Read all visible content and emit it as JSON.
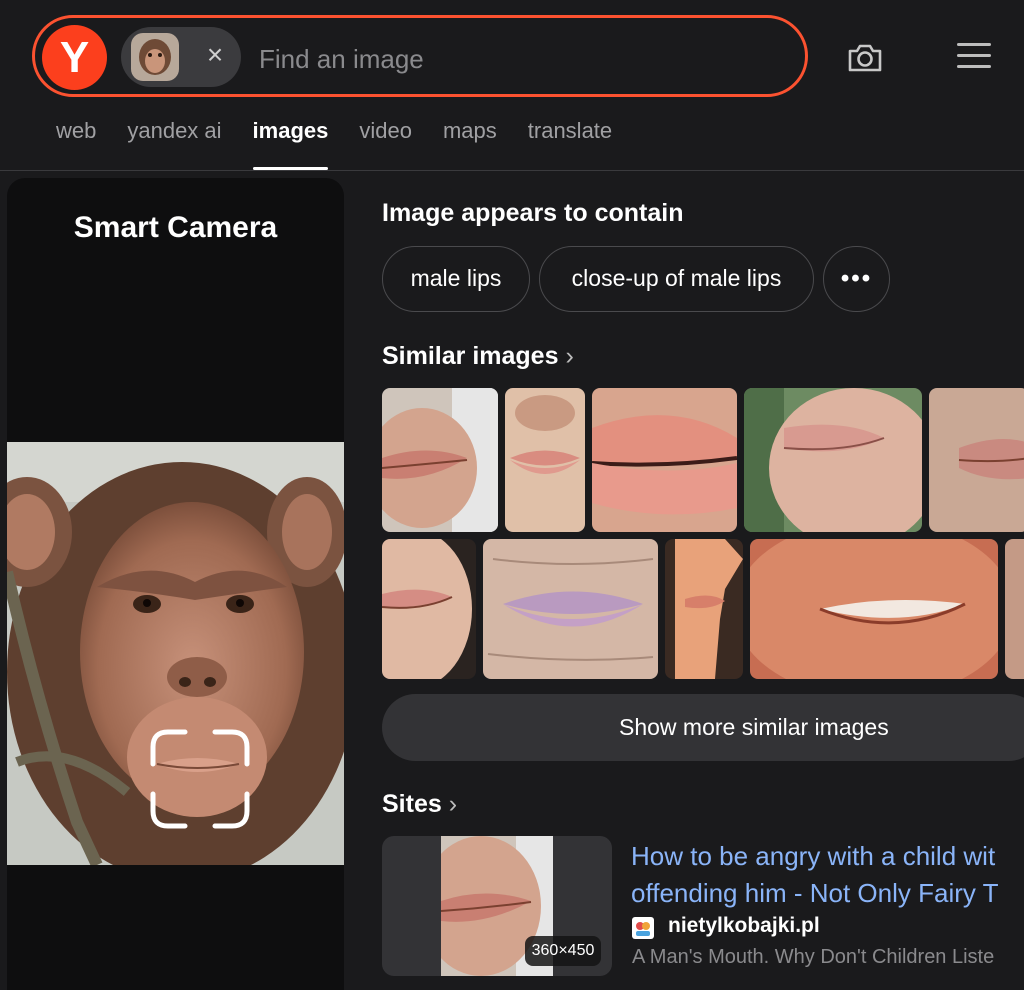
{
  "header": {
    "logo_letter": "Y",
    "search": {
      "placeholder": "Find an image",
      "value": ""
    },
    "chip_close": "×"
  },
  "tabs": [
    "web",
    "yandex ai",
    "images",
    "video",
    "maps",
    "translate"
  ],
  "active_tab": "images",
  "smart_camera": {
    "title": "Smart Camera"
  },
  "contains": {
    "heading": "Image appears to contain",
    "tags": [
      "male lips",
      "close-up of male lips"
    ],
    "more": "•••"
  },
  "similar": {
    "heading": "Similar images",
    "chevron": "›",
    "show_more": "Show more similar images"
  },
  "sites": {
    "heading": "Sites",
    "chevron": "›",
    "result": {
      "size": "360×450",
      "title_line1": "How to be angry with a child wit",
      "title_line2": "offending him - Not Only Fairy T",
      "domain": "nietylkobajki.pl",
      "snippet": "A Man's Mouth. Why Don't Children Liste"
    }
  },
  "colors": {
    "accent": "#fc3f1d",
    "search_border": "#fc5230",
    "background": "#1a1a1c",
    "link": "#8ab4f8"
  },
  "icons": [
    "camera-icon",
    "menu-icon",
    "close-icon",
    "chevron-right-icon",
    "more-icon"
  ]
}
